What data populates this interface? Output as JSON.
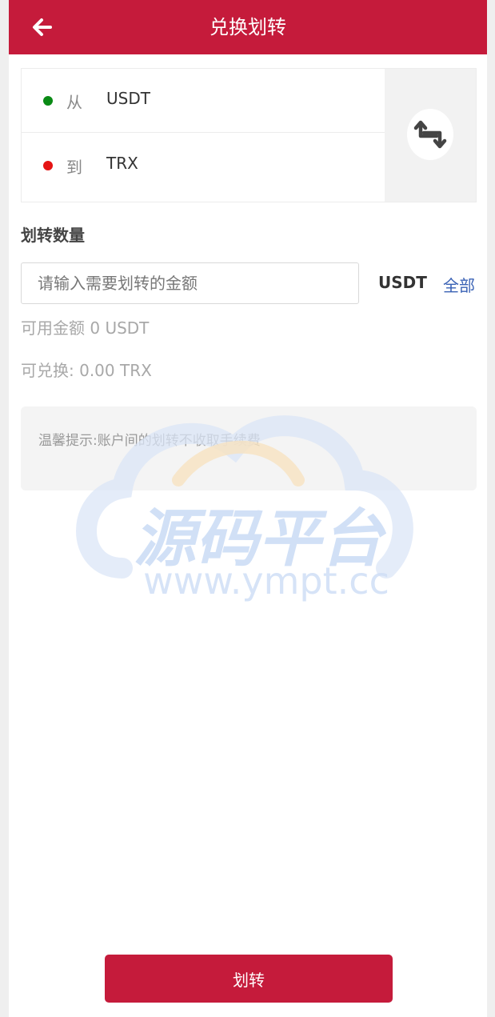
{
  "header": {
    "title": "兑换划转",
    "back_icon": "arrow-left-icon",
    "background": "#c51b3b"
  },
  "swap": {
    "from": {
      "label": "从",
      "coin": "USDT",
      "dot_color": "#0a8a15"
    },
    "to": {
      "label": "到",
      "coin": "TRX",
      "dot_color": "#e51414"
    },
    "swap_icon": "swap-arrows-icon"
  },
  "amount": {
    "section_title": "划转数量",
    "placeholder": "请输入需要划转的金额",
    "value": "",
    "unit": "USDT",
    "all_label": "全部"
  },
  "available": {
    "text": "可用金额 0 USDT"
  },
  "exchangeable": {
    "text": "可兑换: 0.00 TRX"
  },
  "tip": {
    "text": "温馨提示:账户间的划转不收取手续费"
  },
  "watermark": {
    "text": "源码平台",
    "url": "www.ympt.cc"
  },
  "submit": {
    "label": "划转"
  },
  "colors": {
    "brand": "#c51b3b",
    "link": "#3a62b5"
  }
}
